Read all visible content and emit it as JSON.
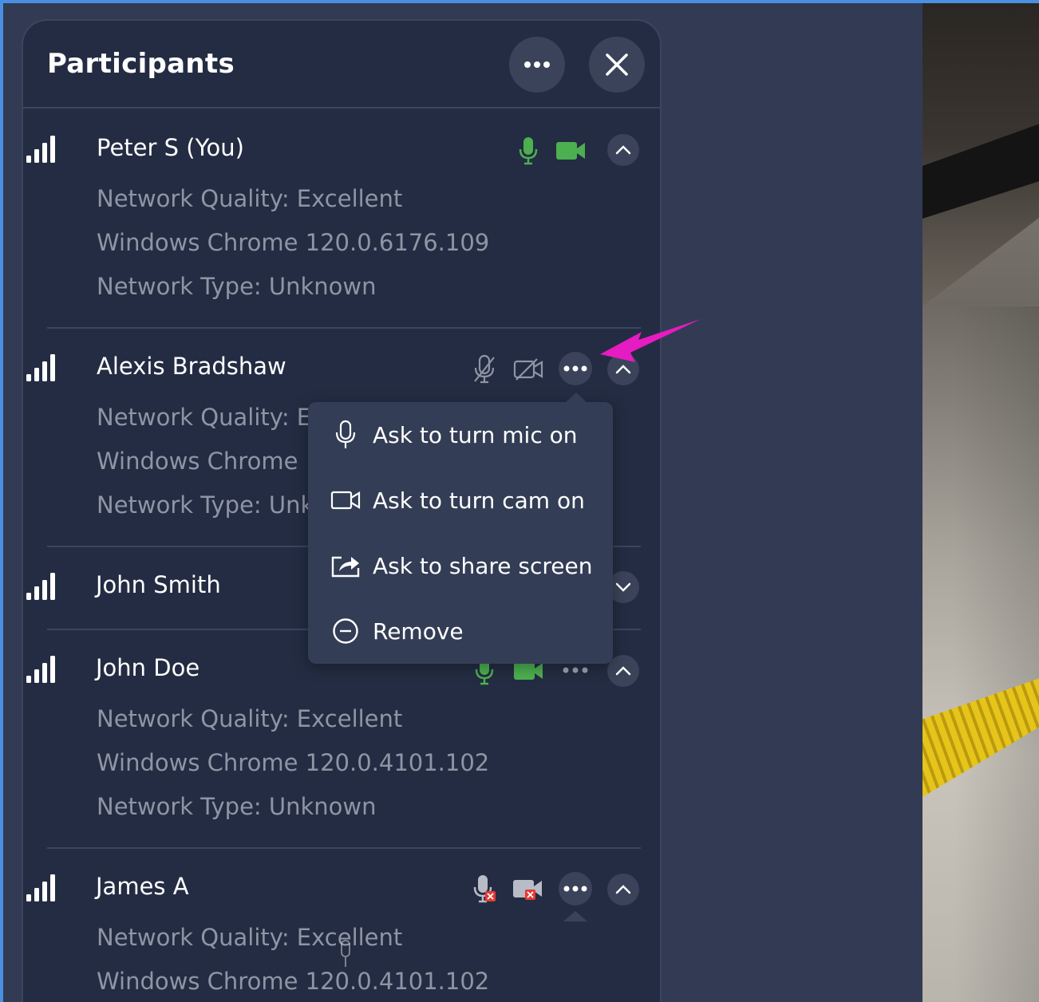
{
  "panel": {
    "title": "Participants",
    "more_icon": "more-horizontal-icon",
    "close_icon": "close-icon"
  },
  "participants": [
    {
      "name": "Peter S (You)",
      "details": [
        "Network Quality: Excellent",
        "Windows Chrome 120.0.6176.109",
        "Network Type: Unknown"
      ],
      "mic": "on",
      "cam": "on",
      "expanded": true
    },
    {
      "name": "Alexis Bradshaw",
      "details": [
        "Network Quality: E",
        "Windows Chrome",
        "Network Type: Unk"
      ],
      "mic": "off",
      "cam": "off",
      "expanded": true
    },
    {
      "name": "John Smith",
      "details": [],
      "expanded": false
    },
    {
      "name": "John Doe",
      "details": [
        "Network Quality: Excellent",
        "Windows Chrome 120.0.4101.102",
        "Network Type: Unknown"
      ],
      "mic": "on",
      "cam": "on",
      "expanded": true
    },
    {
      "name": "James A",
      "details": [
        "Network Quality: Excellent",
        "Windows Chrome 120.0.4101.102"
      ],
      "mic": "blocked",
      "cam": "blocked",
      "expanded": true
    }
  ],
  "menu": {
    "items": [
      {
        "label": "Ask to turn mic on",
        "icon": "microphone-icon"
      },
      {
        "label": "Ask to turn cam on",
        "icon": "video-camera-icon"
      },
      {
        "label": "Ask to share screen",
        "icon": "share-screen-icon"
      },
      {
        "label": "Remove",
        "icon": "remove-circle-icon"
      }
    ]
  },
  "colors": {
    "panel_bg": "#232c42",
    "active_green": "#4caf50",
    "muted_gray": "#8e95a5",
    "annotation_magenta": "#e61bc1",
    "blocked_red": "#e53935"
  }
}
